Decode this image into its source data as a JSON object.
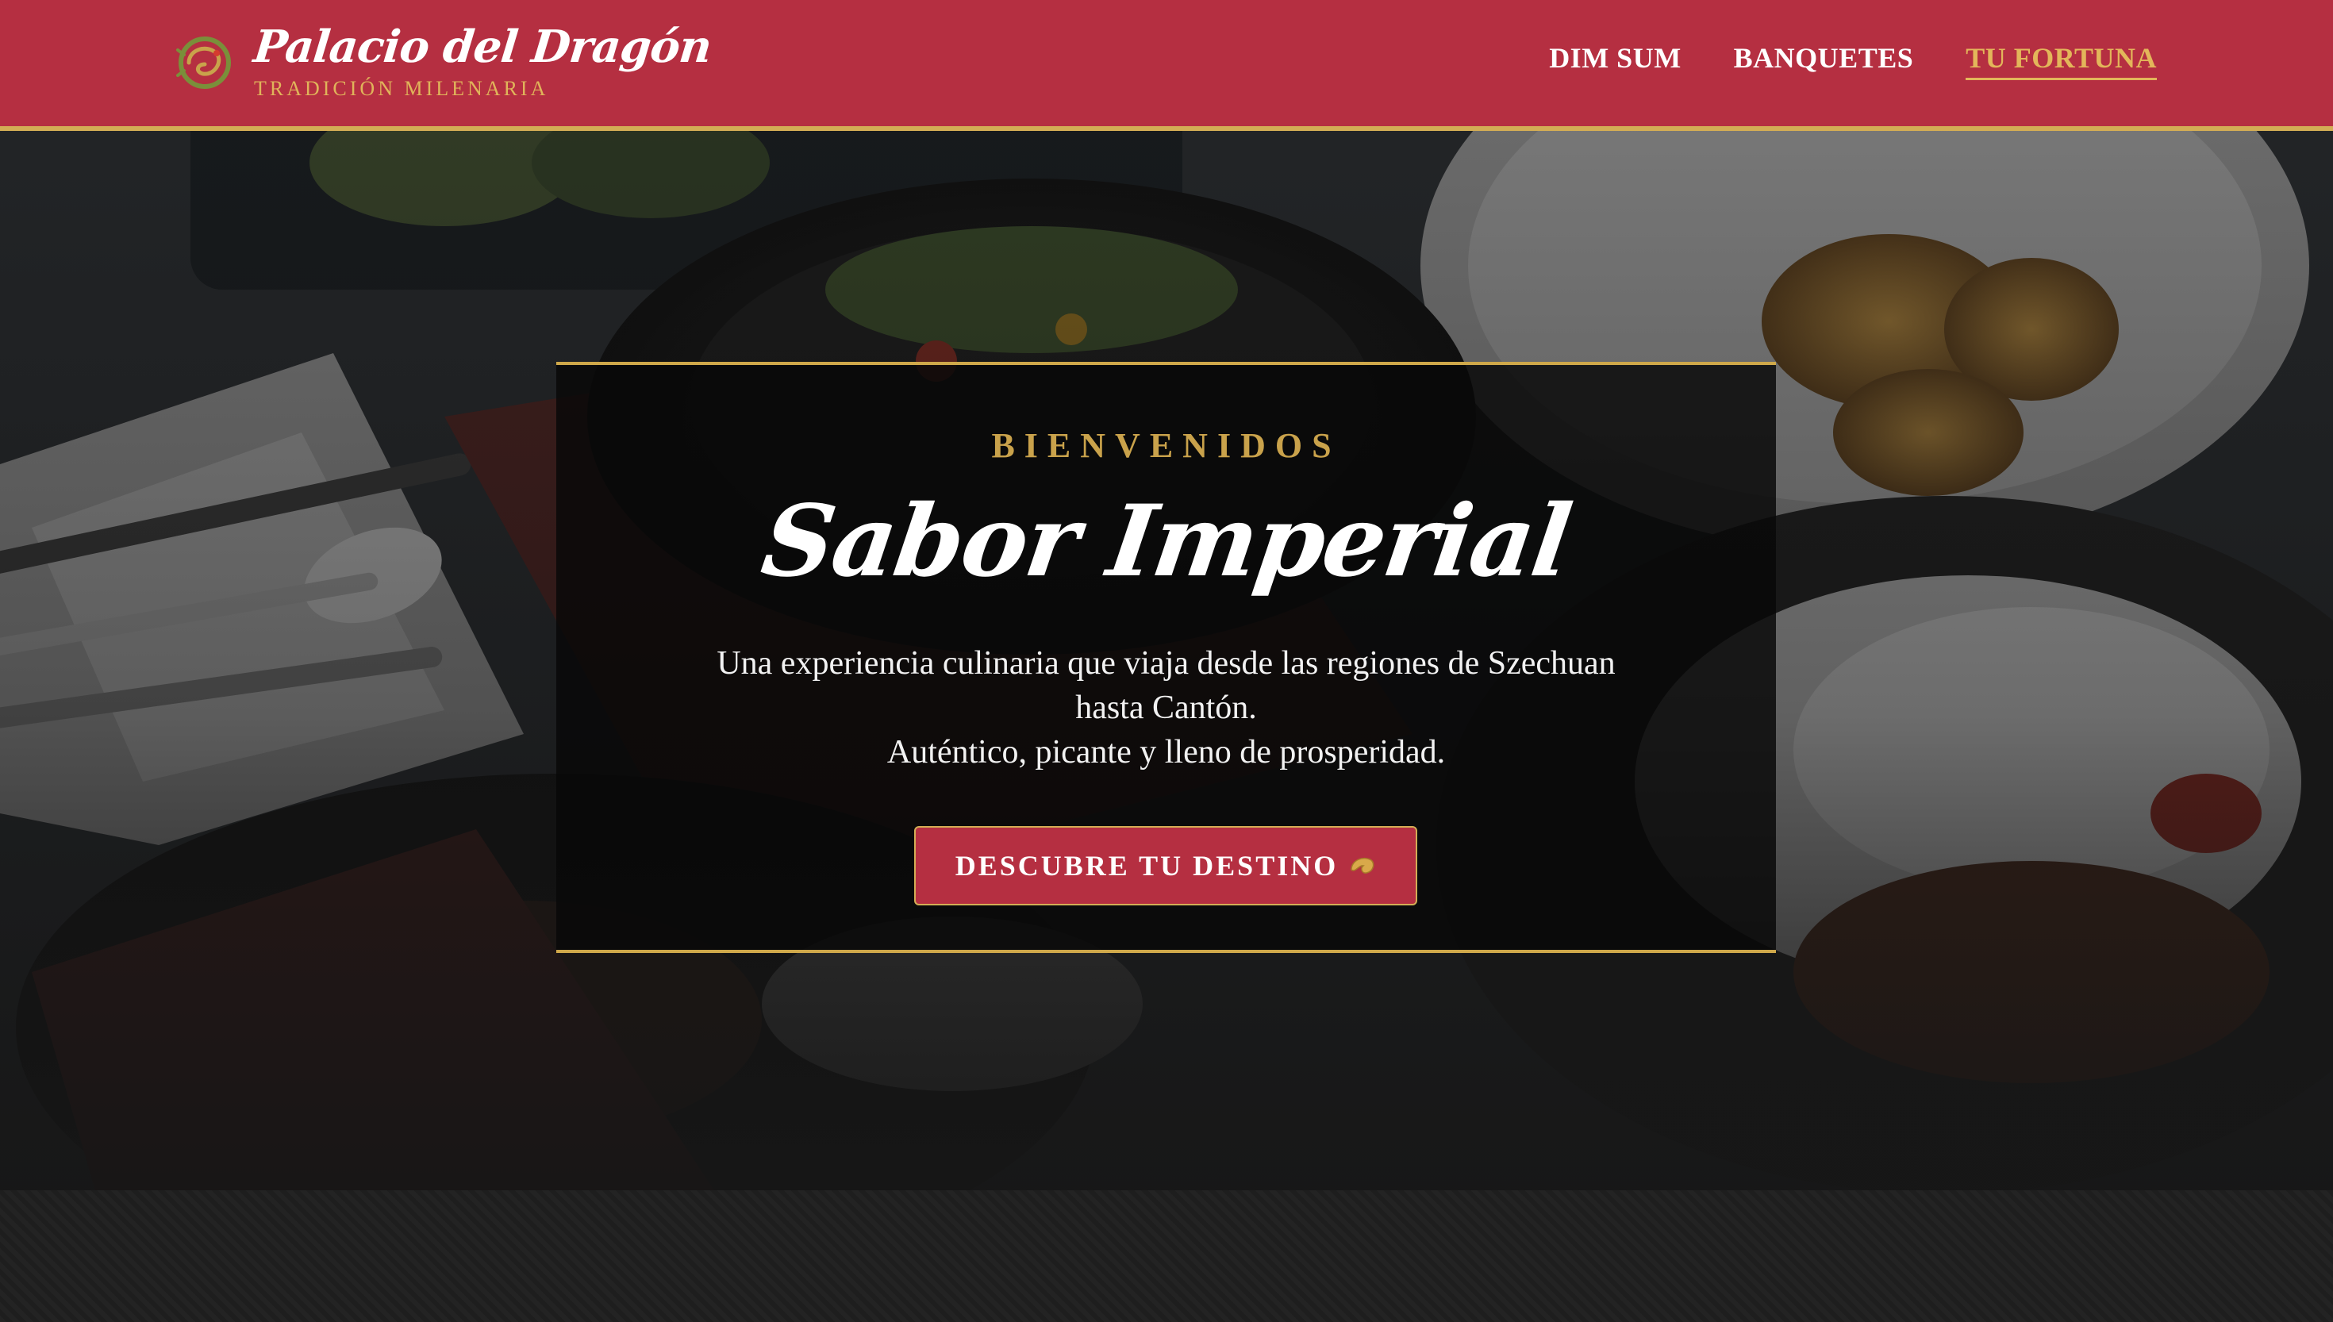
{
  "brand": {
    "name": "Palacio del Dragón",
    "tagline": "TRADICIÓN MILENARIA",
    "logo_icon": "dragon-icon"
  },
  "nav": {
    "items": [
      {
        "label": "DIM SUM",
        "active": false
      },
      {
        "label": "BANQUETES",
        "active": false
      },
      {
        "label": "TU FORTUNA",
        "active": true
      }
    ]
  },
  "hero": {
    "eyebrow": "BIENVENIDOS",
    "title": "Sabor Imperial",
    "description_lines": [
      "Una experiencia culinaria que viaja desde las regiones de Szechuan",
      "hasta Cantón.",
      "Auténtico, picante y lleno de prosperidad."
    ],
    "cta_label": "DESCUBRE TU DESTINO",
    "cta_icon": "fortune-cookie-icon"
  },
  "colors": {
    "header_red": "#b52f41",
    "gold": "#d3ad55",
    "card_bg": "#080808"
  }
}
